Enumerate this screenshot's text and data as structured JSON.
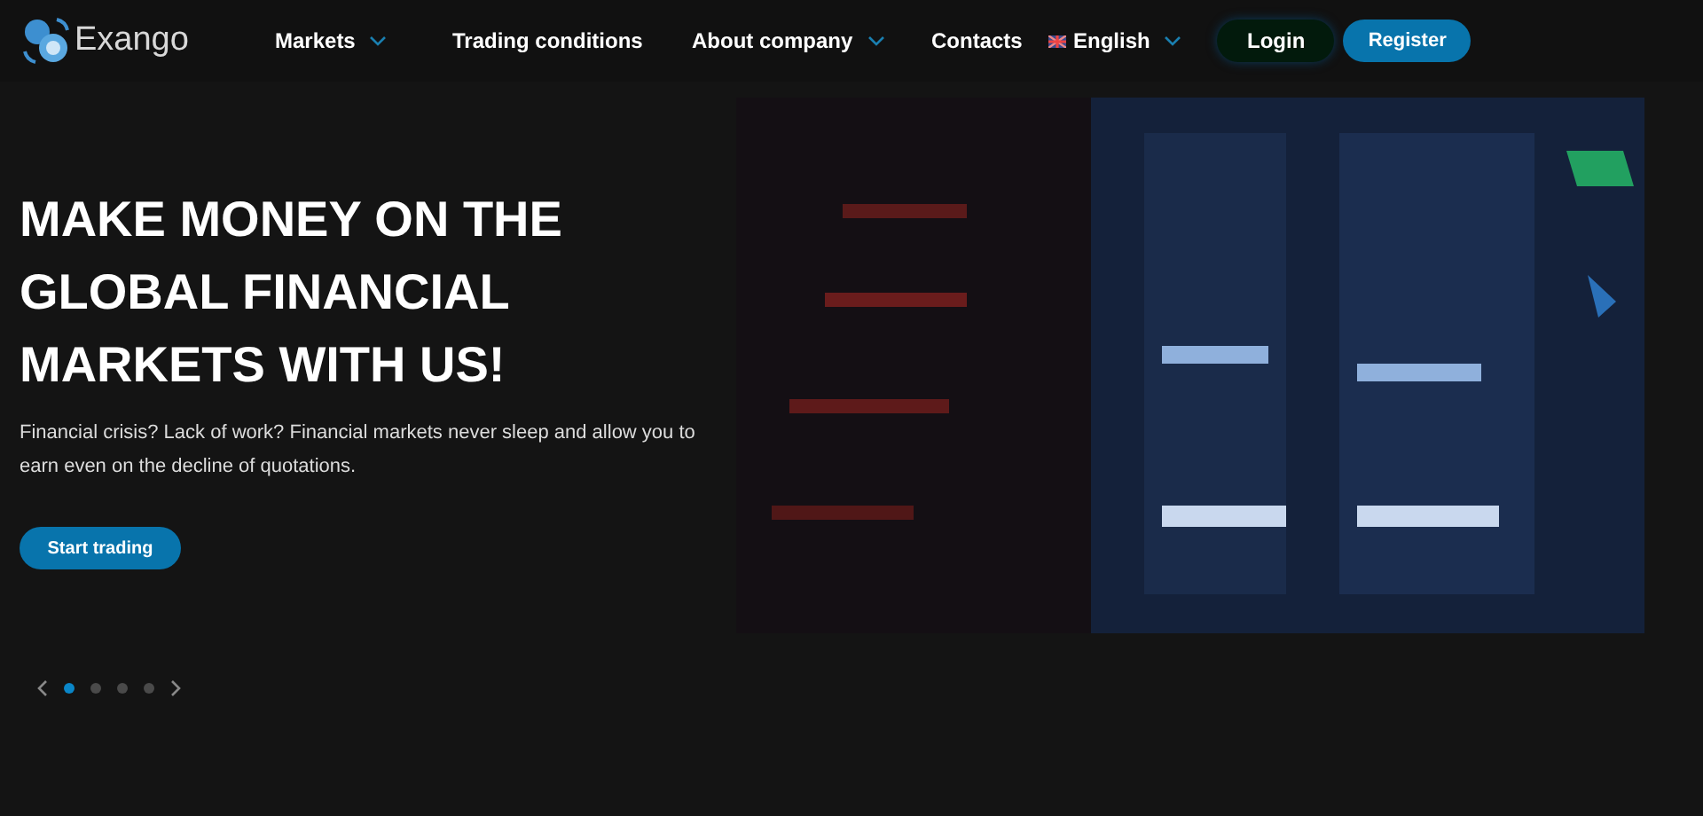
{
  "header": {
    "logo": "Exango",
    "nav": [
      {
        "label": "Markets",
        "dropdown": true
      },
      {
        "label": "Trading conditions",
        "dropdown": false
      },
      {
        "label": "About company",
        "dropdown": true
      },
      {
        "label": "Contacts",
        "dropdown": false
      }
    ],
    "language": "English",
    "login": "Login",
    "register": "Register"
  },
  "hero": {
    "title": "MAKE MONEY ON THE GLOBAL FINANCIAL MARKETS WITH US!",
    "text": "Financial crisis? Lack of work? Financial markets never sleep and allow you to earn even on the decline of quotations.",
    "button": "Start trading"
  },
  "slider": {
    "dots": [
      {
        "selected": true
      },
      {
        "selected": false
      },
      {
        "selected": false
      },
      {
        "selected": false
      }
    ]
  }
}
